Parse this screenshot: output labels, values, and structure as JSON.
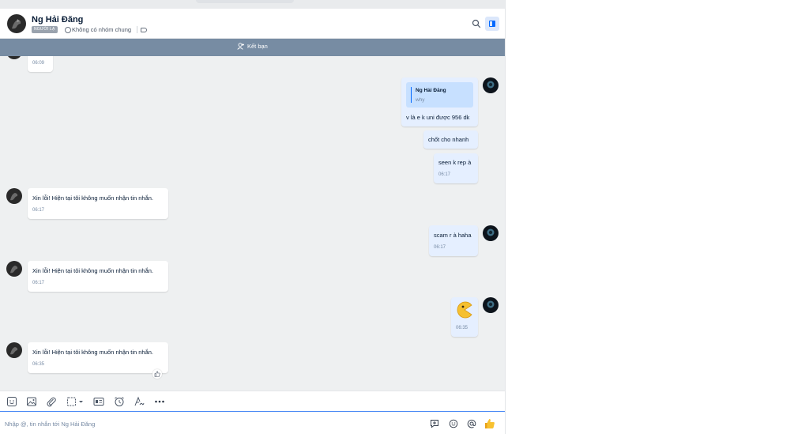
{
  "header": {
    "contact_name": "Ng Hải Đăng",
    "badge": "NGƯỜI LẠ",
    "group_status": "Không có nhóm chung"
  },
  "friend_bar": {
    "label": "Kết bạn"
  },
  "messages": {
    "m0": {
      "time": "06:09"
    },
    "m1": {
      "quote_name": "Ng Hải Đăng",
      "quote_text": "why",
      "text": "v là e k uni được 956 dk"
    },
    "m2": {
      "text": "chốt cho nhanh"
    },
    "m3": {
      "text": "seen k rep à",
      "time": "06:17"
    },
    "m4": {
      "text": "Xin lỗi! Hiện tại tôi không muốn nhận tin nhắn.",
      "time": "06:17"
    },
    "m5": {
      "text": "scam r à haha",
      "time": "06:17"
    },
    "m6": {
      "text": "Xin lỗi! Hiện tại tôi không muốn nhận tin nhắn.",
      "time": "06:17"
    },
    "m7": {
      "time": "06:35"
    },
    "m8": {
      "text": "Xin lỗi! Hiện tại tôi không muốn nhận tin nhắn.",
      "time": "06:35"
    }
  },
  "composer": {
    "placeholder": "Nhập @, tin nhắn tới Ng Hải Đăng"
  },
  "icons": {
    "toolbar": [
      "sticker-icon",
      "image-icon",
      "attachment-icon",
      "screenshot-icon",
      "business-card-icon",
      "reminder-icon",
      "format-text-icon",
      "more-icon"
    ],
    "input": [
      "quick-message-icon",
      "emoji-icon",
      "mention-icon",
      "thumbs-up-icon"
    ]
  },
  "colors": {
    "accent": "#0068ff",
    "friend_bar": "#778ca3",
    "outgoing_bubble": "#e5efff",
    "incoming_bubble": "#ffffff",
    "chat_background": "#eef0f1"
  }
}
